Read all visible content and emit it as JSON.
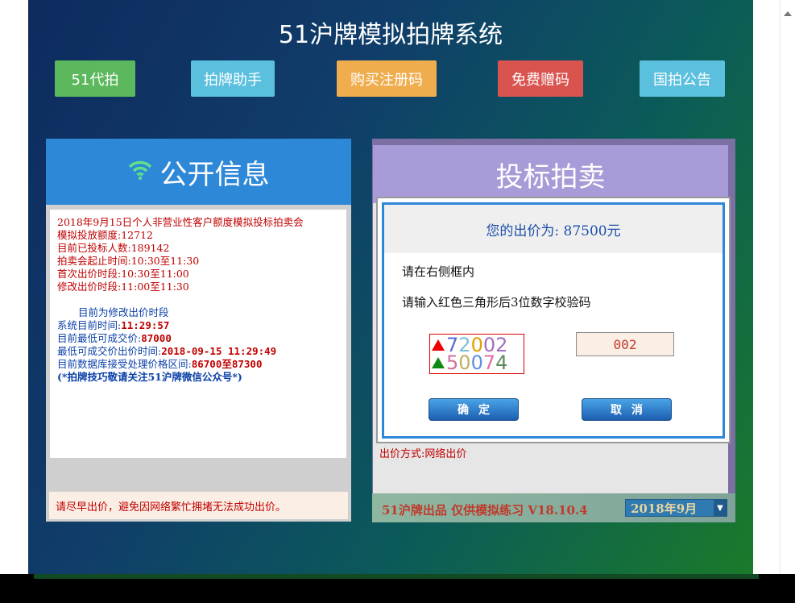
{
  "app": {
    "title": "51沪牌模拟拍牌系统"
  },
  "nav": [
    {
      "label": "51代拍",
      "color": "#5cb85c"
    },
    {
      "label": "拍牌助手",
      "color": "#5bc0de"
    },
    {
      "label": "购买注册码",
      "color": "#f0ad4e"
    },
    {
      "label": "免费赠码",
      "color": "#d9534f"
    },
    {
      "label": "国拍公告",
      "color": "#5bc0de"
    }
  ],
  "left_panel": {
    "title": "公开信息",
    "info": {
      "auction_name": "2018年9月15日个人非营业性客户额度模拟投标拍卖会",
      "quota": "模拟投放额度:12712",
      "bidders": "目前已投标人数:189142",
      "auction_time": "拍卖会起止时间:10:30至11:30",
      "first_bid_time": "首次出价时段:10:30至11:00",
      "modify_time": "修改出价时段:11:00至11:30",
      "current_phase": "目前为修改出价时段",
      "system_time_label": "系统目前时间:",
      "system_time": "11:29:57",
      "lowest_price_label": "目前最低可成交价:",
      "lowest_price": "87000",
      "lowest_time_label": "最低可成交价出价时间:",
      "lowest_time": "2018-09-15 11:29:49",
      "range_label": "目前数据库接受处理价格区间:",
      "range": "86700至87300",
      "promo": "(*拍牌技巧敬请关注51沪牌微信公众号*)"
    },
    "warning": "请尽早出价，避免因网络繁忙拥堵无法成功出价。"
  },
  "right_panel": {
    "title": "投标拍卖",
    "bid_method": "出价方式:网络出价",
    "footer": "51沪牌出品  仅供模拟练习  V18.10.4",
    "month": "2018年9月"
  },
  "dialog": {
    "price_text": "您的出价为: 87500元",
    "instruction1": "请在右侧框内",
    "instruction2": "请输入红色三角形后3位数字校验码",
    "captcha_row1": [
      "7",
      "2",
      "0",
      "0",
      "2"
    ],
    "captcha_row2": [
      "5",
      "0",
      "0",
      "7",
      "4"
    ],
    "captcha_colors1": [
      "#5b6bd6",
      "#7bc0d6",
      "#e0a000",
      "#a070c0",
      "#a070c0"
    ],
    "captcha_colors2": [
      "#d070a0",
      "#c0b060",
      "#6090e0",
      "#e070a0",
      "#5b8a5b"
    ],
    "code_value": "002",
    "confirm": "确定",
    "cancel": "取消"
  }
}
